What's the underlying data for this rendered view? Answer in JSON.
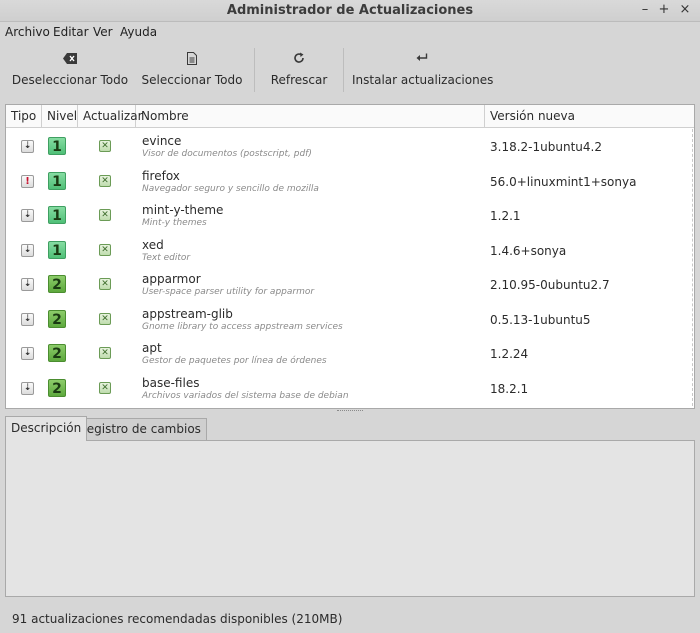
{
  "window": {
    "title": "Administrador de Actualizaciones",
    "controls": {
      "minimize": "–",
      "maximize": "+",
      "close": "×"
    }
  },
  "menubar": {
    "items": [
      {
        "label": "Archivo"
      },
      {
        "label": "Editar"
      },
      {
        "label": "Ver"
      },
      {
        "label": "Ayuda"
      }
    ]
  },
  "toolbar": {
    "deselect_all": {
      "label": "Deseleccionar Todo",
      "icon": "backspace-icon"
    },
    "select_all": {
      "label": "Seleccionar Todo",
      "icon": "document-icon"
    },
    "refresh": {
      "label": "Refrescar",
      "icon": "refresh-icon"
    },
    "install": {
      "label": "Instalar actualizaciones",
      "icon": "enter-icon"
    }
  },
  "table": {
    "headers": {
      "type": "Tipo",
      "level": "Nivel",
      "update": "Actualizar",
      "name": "Nombre",
      "version": "Versión nueva"
    },
    "rows": [
      {
        "type": "package",
        "type_glyph": "⇣",
        "level": "1",
        "checked": true,
        "check_glyph": "✕",
        "name": "evince",
        "desc": "Visor de documentos (postscript, pdf)",
        "version": "3.18.2-1ubuntu4.2"
      },
      {
        "type": "security",
        "type_glyph": "!",
        "level": "1",
        "checked": true,
        "check_glyph": "✕",
        "name": "firefox",
        "desc": "Navegador seguro y sencillo de mozilla",
        "version": "56.0+linuxmint1+sonya"
      },
      {
        "type": "package",
        "type_glyph": "⇣",
        "level": "1",
        "checked": true,
        "check_glyph": "✕",
        "name": "mint-y-theme",
        "desc": "Mint-y themes",
        "version": "1.2.1"
      },
      {
        "type": "package",
        "type_glyph": "⇣",
        "level": "1",
        "checked": true,
        "check_glyph": "✕",
        "name": "xed",
        "desc": "Text editor",
        "version": "1.4.6+sonya"
      },
      {
        "type": "package",
        "type_glyph": "⇣",
        "level": "2",
        "checked": true,
        "check_glyph": "✕",
        "name": "apparmor",
        "desc": "User-space parser utility for apparmor",
        "version": "2.10.95-0ubuntu2.7"
      },
      {
        "type": "package",
        "type_glyph": "⇣",
        "level": "2",
        "checked": true,
        "check_glyph": "✕",
        "name": "appstream-glib",
        "desc": "Gnome library to access appstream services",
        "version": "0.5.13-1ubuntu5"
      },
      {
        "type": "package",
        "type_glyph": "⇣",
        "level": "2",
        "checked": true,
        "check_glyph": "✕",
        "name": "apt",
        "desc": "Gestor de paquetes por línea de órdenes",
        "version": "1.2.24"
      },
      {
        "type": "package",
        "type_glyph": "⇣",
        "level": "2",
        "checked": true,
        "check_glyph": "✕",
        "name": "base-files",
        "desc": "Archivos variados del sistema base de debian",
        "version": "18.2.1"
      }
    ]
  },
  "tabs": [
    {
      "label": "Descripción",
      "active": true
    },
    {
      "label": "Registro de cambios",
      "active": false
    }
  ],
  "status": {
    "text": "91 actualizaciones recomendadas disponibles (210MB)"
  },
  "colors": {
    "level1": "#4fbf77",
    "level2": "#5da83d",
    "security": "#c8102e"
  }
}
